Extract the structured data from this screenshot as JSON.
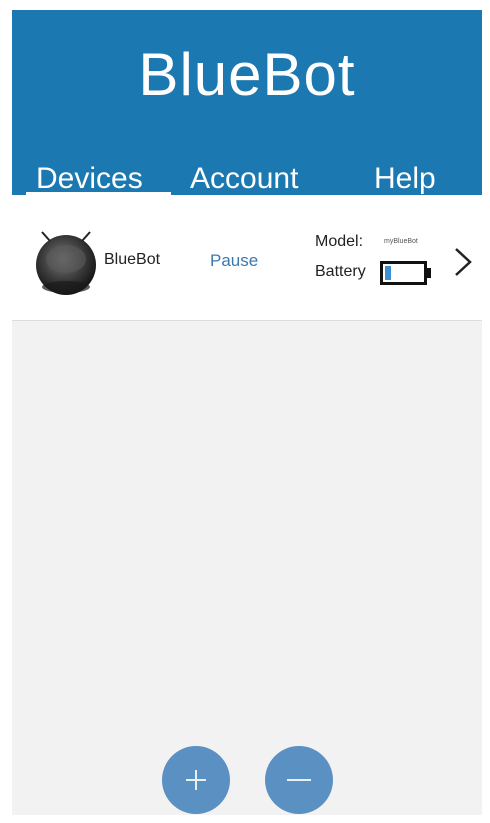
{
  "app": {
    "title": "BlueBot"
  },
  "tabs": [
    {
      "label": "Devices",
      "active": true
    },
    {
      "label": "Account",
      "active": false
    },
    {
      "label": "Help",
      "active": false
    }
  ],
  "devices": [
    {
      "name": "BlueBot",
      "status": "Pause",
      "model_label": "Model:",
      "model_value": "myBlueBot",
      "battery_label": "Battery",
      "battery_level": 0.15,
      "icons": {
        "avatar": "robot-vacuum-icon",
        "battery": "battery-icon",
        "chevron": "chevron-right-icon"
      }
    }
  ],
  "actions": {
    "add_icon": "plus-icon",
    "remove_icon": "minus-icon"
  },
  "colors": {
    "header": "#1b78b0",
    "fab": "#5b91c2",
    "status_text": "#3a79b0",
    "battery_fill": "#3c8fd0",
    "background": "#f2f2f2"
  }
}
